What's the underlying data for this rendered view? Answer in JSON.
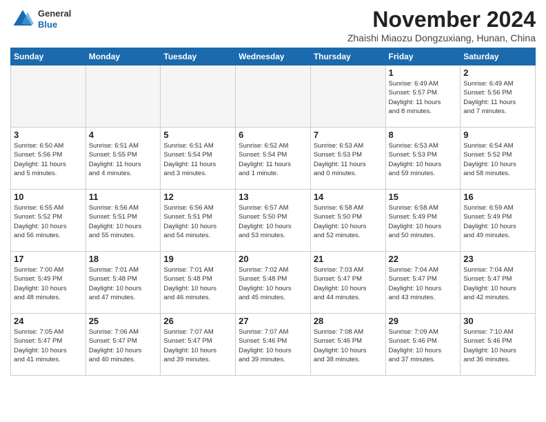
{
  "header": {
    "logo": {
      "general": "General",
      "blue": "Blue"
    },
    "title": "November 2024",
    "location": "Zhaishi Miaozu Dongzuxiang, Hunan, China"
  },
  "weekdays": [
    "Sunday",
    "Monday",
    "Tuesday",
    "Wednesday",
    "Thursday",
    "Friday",
    "Saturday"
  ],
  "weeks": [
    [
      {
        "day": "",
        "info": ""
      },
      {
        "day": "",
        "info": ""
      },
      {
        "day": "",
        "info": ""
      },
      {
        "day": "",
        "info": ""
      },
      {
        "day": "",
        "info": ""
      },
      {
        "day": "1",
        "info": "Sunrise: 6:49 AM\nSunset: 5:57 PM\nDaylight: 11 hours\nand 8 minutes."
      },
      {
        "day": "2",
        "info": "Sunrise: 6:49 AM\nSunset: 5:56 PM\nDaylight: 11 hours\nand 7 minutes."
      }
    ],
    [
      {
        "day": "3",
        "info": "Sunrise: 6:50 AM\nSunset: 5:56 PM\nDaylight: 11 hours\nand 5 minutes."
      },
      {
        "day": "4",
        "info": "Sunrise: 6:51 AM\nSunset: 5:55 PM\nDaylight: 11 hours\nand 4 minutes."
      },
      {
        "day": "5",
        "info": "Sunrise: 6:51 AM\nSunset: 5:54 PM\nDaylight: 11 hours\nand 3 minutes."
      },
      {
        "day": "6",
        "info": "Sunrise: 6:52 AM\nSunset: 5:54 PM\nDaylight: 11 hours\nand 1 minute."
      },
      {
        "day": "7",
        "info": "Sunrise: 6:53 AM\nSunset: 5:53 PM\nDaylight: 11 hours\nand 0 minutes."
      },
      {
        "day": "8",
        "info": "Sunrise: 6:53 AM\nSunset: 5:53 PM\nDaylight: 10 hours\nand 59 minutes."
      },
      {
        "day": "9",
        "info": "Sunrise: 6:54 AM\nSunset: 5:52 PM\nDaylight: 10 hours\nand 58 minutes."
      }
    ],
    [
      {
        "day": "10",
        "info": "Sunrise: 6:55 AM\nSunset: 5:52 PM\nDaylight: 10 hours\nand 56 minutes."
      },
      {
        "day": "11",
        "info": "Sunrise: 6:56 AM\nSunset: 5:51 PM\nDaylight: 10 hours\nand 55 minutes."
      },
      {
        "day": "12",
        "info": "Sunrise: 6:56 AM\nSunset: 5:51 PM\nDaylight: 10 hours\nand 54 minutes."
      },
      {
        "day": "13",
        "info": "Sunrise: 6:57 AM\nSunset: 5:50 PM\nDaylight: 10 hours\nand 53 minutes."
      },
      {
        "day": "14",
        "info": "Sunrise: 6:58 AM\nSunset: 5:50 PM\nDaylight: 10 hours\nand 52 minutes."
      },
      {
        "day": "15",
        "info": "Sunrise: 6:58 AM\nSunset: 5:49 PM\nDaylight: 10 hours\nand 50 minutes."
      },
      {
        "day": "16",
        "info": "Sunrise: 6:59 AM\nSunset: 5:49 PM\nDaylight: 10 hours\nand 49 minutes."
      }
    ],
    [
      {
        "day": "17",
        "info": "Sunrise: 7:00 AM\nSunset: 5:49 PM\nDaylight: 10 hours\nand 48 minutes."
      },
      {
        "day": "18",
        "info": "Sunrise: 7:01 AM\nSunset: 5:48 PM\nDaylight: 10 hours\nand 47 minutes."
      },
      {
        "day": "19",
        "info": "Sunrise: 7:01 AM\nSunset: 5:48 PM\nDaylight: 10 hours\nand 46 minutes."
      },
      {
        "day": "20",
        "info": "Sunrise: 7:02 AM\nSunset: 5:48 PM\nDaylight: 10 hours\nand 45 minutes."
      },
      {
        "day": "21",
        "info": "Sunrise: 7:03 AM\nSunset: 5:47 PM\nDaylight: 10 hours\nand 44 minutes."
      },
      {
        "day": "22",
        "info": "Sunrise: 7:04 AM\nSunset: 5:47 PM\nDaylight: 10 hours\nand 43 minutes."
      },
      {
        "day": "23",
        "info": "Sunrise: 7:04 AM\nSunset: 5:47 PM\nDaylight: 10 hours\nand 42 minutes."
      }
    ],
    [
      {
        "day": "24",
        "info": "Sunrise: 7:05 AM\nSunset: 5:47 PM\nDaylight: 10 hours\nand 41 minutes."
      },
      {
        "day": "25",
        "info": "Sunrise: 7:06 AM\nSunset: 5:47 PM\nDaylight: 10 hours\nand 40 minutes."
      },
      {
        "day": "26",
        "info": "Sunrise: 7:07 AM\nSunset: 5:47 PM\nDaylight: 10 hours\nand 39 minutes."
      },
      {
        "day": "27",
        "info": "Sunrise: 7:07 AM\nSunset: 5:46 PM\nDaylight: 10 hours\nand 39 minutes."
      },
      {
        "day": "28",
        "info": "Sunrise: 7:08 AM\nSunset: 5:46 PM\nDaylight: 10 hours\nand 38 minutes."
      },
      {
        "day": "29",
        "info": "Sunrise: 7:09 AM\nSunset: 5:46 PM\nDaylight: 10 hours\nand 37 minutes."
      },
      {
        "day": "30",
        "info": "Sunrise: 7:10 AM\nSunset: 5:46 PM\nDaylight: 10 hours\nand 36 minutes."
      }
    ]
  ]
}
